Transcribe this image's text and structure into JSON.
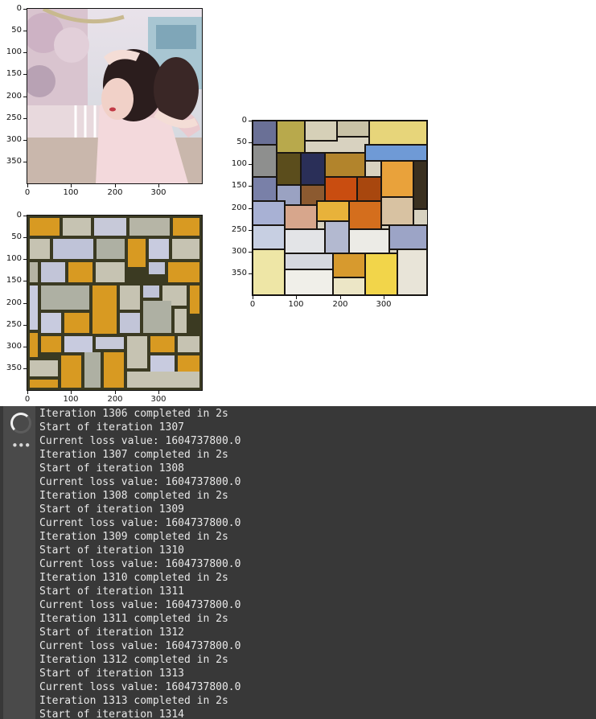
{
  "plots": [
    {
      "id": "content",
      "image": "photo-of-woman-with-hair-up",
      "x_ticks": [
        "0",
        "100",
        "200",
        "300"
      ],
      "y_ticks": [
        "0",
        "50",
        "100",
        "150",
        "200",
        "250",
        "300",
        "350"
      ]
    },
    {
      "id": "generated",
      "image": "stylized-output-patchwork",
      "x_ticks": [
        "0",
        "100",
        "200",
        "300"
      ],
      "y_ticks": [
        "0",
        "50",
        "100",
        "150",
        "200",
        "250",
        "300",
        "350"
      ]
    },
    {
      "id": "style",
      "image": "mondrian-composition-grid",
      "x_ticks": [
        "0",
        "100",
        "200",
        "300"
      ],
      "y_ticks": [
        "0",
        "50",
        "100",
        "150",
        "200",
        "250",
        "300",
        "350"
      ]
    }
  ],
  "console": {
    "running_icon": "spinner-icon",
    "more_icon": "more-horizontal-icon",
    "more_label": "•••",
    "colors": {
      "background": "#383838",
      "gutter": "#4a4a4a",
      "text": "#e8e8e8"
    },
    "lines": [
      "Iteration 1306 completed in 2s",
      "Start of iteration 1307",
      "Current loss value: 1604737800.0",
      "Iteration 1307 completed in 2s",
      "Start of iteration 1308",
      "Current loss value: 1604737800.0",
      "Iteration 1308 completed in 2s",
      "Start of iteration 1309",
      "Current loss value: 1604737800.0",
      "Iteration 1309 completed in 2s",
      "Start of iteration 1310",
      "Current loss value: 1604737800.0",
      "Iteration 1310 completed in 2s",
      "Start of iteration 1311",
      "Current loss value: 1604737800.0",
      "Iteration 1311 completed in 2s",
      "Start of iteration 1312",
      "Current loss value: 1604737800.0",
      "Iteration 1312 completed in 2s",
      "Start of iteration 1313",
      "Current loss value: 1604737800.0",
      "Iteration 1313 completed in 2s",
      "Start of iteration 1314"
    ]
  }
}
